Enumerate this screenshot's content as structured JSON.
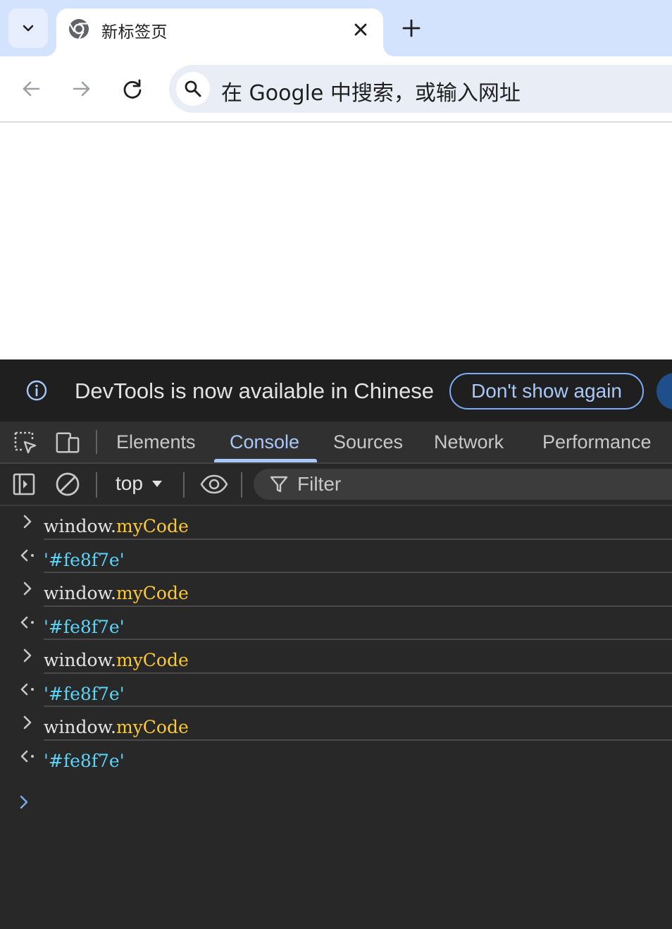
{
  "browser": {
    "tab_title": "新标签页",
    "omnibox_placeholder": "在 Google 中搜索，或输入网址",
    "icons": {
      "tab_search": "chevron-down-icon",
      "favicon": "chrome-icon",
      "tab_close": "close-icon",
      "new_tab": "plus-icon",
      "back": "arrow-left-icon",
      "forward": "arrow-right-icon",
      "reload": "reload-icon",
      "omnibox_search": "search-icon"
    }
  },
  "devtools": {
    "infobar": {
      "message": "DevTools is now available in Chinese",
      "dismiss_label": "Don't show again"
    },
    "tabs": [
      {
        "label": "Elements",
        "active": false
      },
      {
        "label": "Console",
        "active": true
      },
      {
        "label": "Sources",
        "active": false
      },
      {
        "label": "Network",
        "active": false
      },
      {
        "label": "Performance",
        "active": false
      }
    ],
    "console_toolbar": {
      "context": "top",
      "filter_placeholder": "Filter"
    },
    "console_entries": [
      {
        "kind": "input",
        "object": "window",
        "dot": ".",
        "property": "myCode"
      },
      {
        "kind": "output",
        "value": "'#fe8f7e'"
      },
      {
        "kind": "input",
        "object": "window",
        "dot": ".",
        "property": "myCode"
      },
      {
        "kind": "output",
        "value": "'#fe8f7e'"
      },
      {
        "kind": "input",
        "object": "window",
        "dot": ".",
        "property": "myCode"
      },
      {
        "kind": "output",
        "value": "'#fe8f7e'"
      },
      {
        "kind": "input",
        "object": "window",
        "dot": ".",
        "property": "myCode"
      },
      {
        "kind": "output",
        "value": "'#fe8f7e'"
      }
    ],
    "colors": {
      "accent": "#a8c7fa",
      "property": "#fcc934",
      "string": "#5cd5fb"
    }
  }
}
